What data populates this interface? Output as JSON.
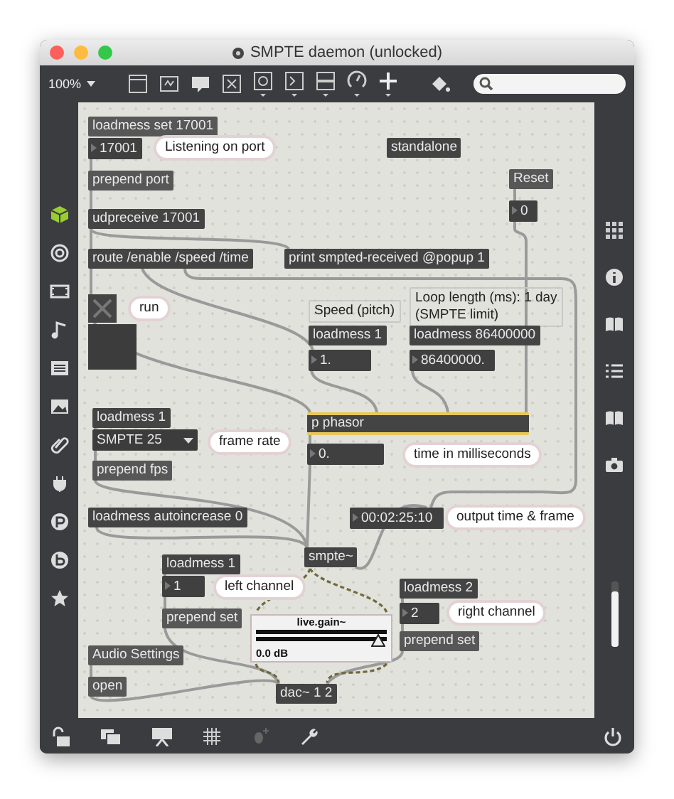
{
  "window": {
    "title": "SMPTE daemon (unlocked)"
  },
  "sidebar": {
    "volume": {
      "level": 0.85
    }
  },
  "toolbar": {
    "zoom": "100%"
  },
  "objects": [
    {
      "kind": "message",
      "text": "loadmess set 17001"
    },
    {
      "kind": "number",
      "text": "17001"
    },
    {
      "kind": "bubble",
      "text": "Listening on port"
    },
    {
      "kind": "object",
      "text": "standalone"
    },
    {
      "kind": "message",
      "text": "prepend port"
    },
    {
      "kind": "message",
      "text": "Reset"
    },
    {
      "kind": "number",
      "text": "0"
    },
    {
      "kind": "object",
      "text": "udpreceive 17001"
    },
    {
      "kind": "object",
      "text": "route /enable /speed /time"
    },
    {
      "kind": "object",
      "text": "print smpted-received @popup 1"
    },
    {
      "kind": "toggle",
      "checked": false
    },
    {
      "kind": "bubble",
      "text": "run"
    },
    {
      "kind": "panel"
    },
    {
      "kind": "comment",
      "text": "Speed (pitch)"
    },
    {
      "kind": "object",
      "text": "loadmess 1"
    },
    {
      "kind": "number",
      "text": "1."
    },
    {
      "kind": "comment",
      "text": "Loop length (ms): 1 day (SMPTE limit)"
    },
    {
      "kind": "object",
      "text": "loadmess 86400000"
    },
    {
      "kind": "number",
      "text": "86400000."
    },
    {
      "kind": "object",
      "text": "loadmess 1"
    },
    {
      "kind": "menu",
      "text": "SMPTE 25"
    },
    {
      "kind": "bubble",
      "text": "frame rate"
    },
    {
      "kind": "message",
      "text": "prepend fps"
    },
    {
      "kind": "patcher",
      "text": "p phasor"
    },
    {
      "kind": "number",
      "text": "0."
    },
    {
      "kind": "bubble",
      "text": "time in milliseconds"
    },
    {
      "kind": "object",
      "text": "loadmess autoincrease 0"
    },
    {
      "kind": "number",
      "text": "00:02:25:10"
    },
    {
      "kind": "bubble",
      "text": "output time & frame"
    },
    {
      "kind": "object",
      "text": "smpte~"
    },
    {
      "kind": "object",
      "text": "loadmess 1"
    },
    {
      "kind": "number",
      "text": "1"
    },
    {
      "kind": "bubble",
      "text": "left channel"
    },
    {
      "kind": "message",
      "text": "prepend set"
    },
    {
      "kind": "gain",
      "title": "live.gain~",
      "reading": "0.0 dB",
      "level": 0.93
    },
    {
      "kind": "object",
      "text": "loadmess 2"
    },
    {
      "kind": "number",
      "text": "2"
    },
    {
      "kind": "bubble",
      "text": "right channel"
    },
    {
      "kind": "message",
      "text": "prepend set"
    },
    {
      "kind": "message",
      "text": "Audio Settings"
    },
    {
      "kind": "message",
      "text": "open"
    },
    {
      "kind": "object",
      "text": "dac~ 1 2"
    }
  ]
}
